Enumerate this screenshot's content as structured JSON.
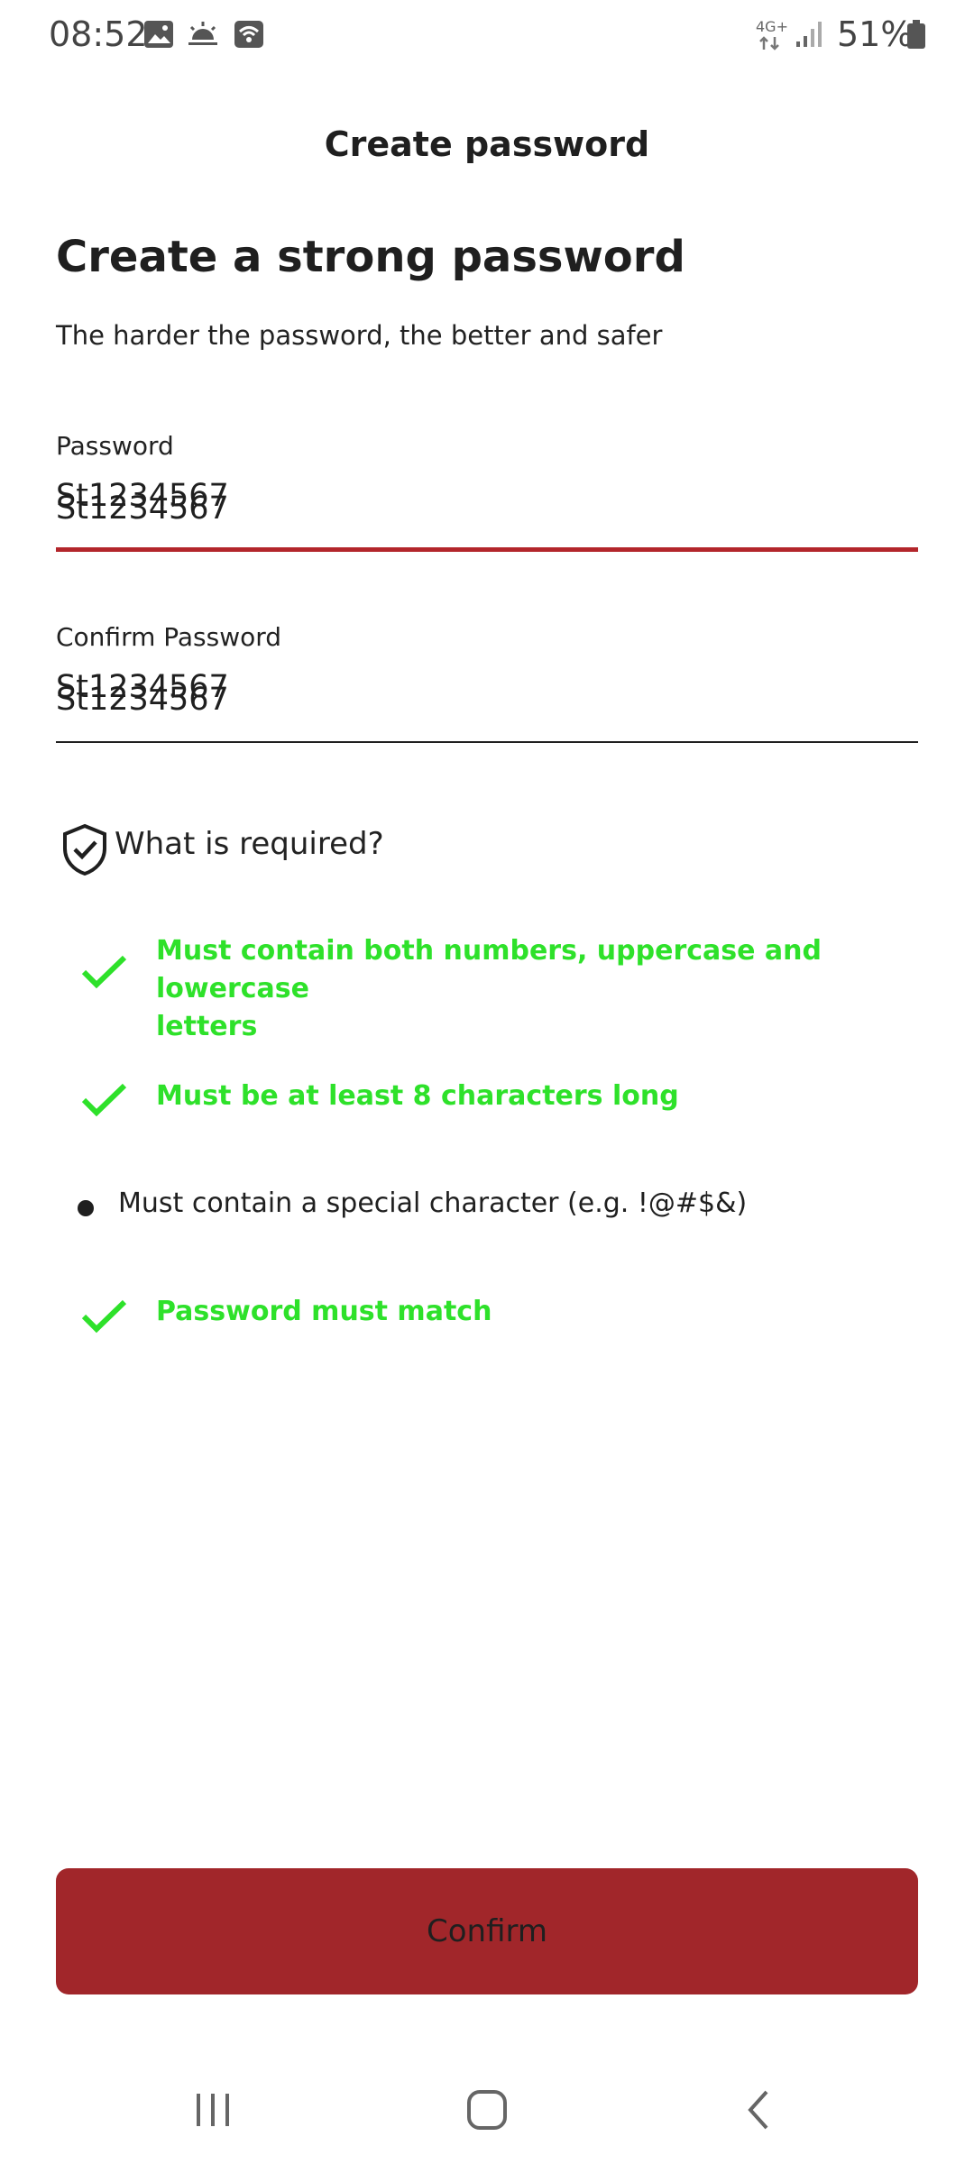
{
  "status_bar": {
    "time": "08:52",
    "network": "4G+",
    "battery_percent": "51%",
    "icons": [
      "image-icon",
      "weather-icon",
      "wifi-call-icon",
      "network-arrows-icon",
      "signal-icon",
      "battery-icon"
    ]
  },
  "header": {
    "title": "Create password"
  },
  "main": {
    "heading": "Create a strong password",
    "subtitle": "The harder the password, the better and safer",
    "password_field": {
      "label": "Password",
      "value": "St1234567",
      "underline_color": "#b3262b"
    },
    "confirm_field": {
      "label": "Confirm Password",
      "value": "St1234567",
      "underline_color": "#1f1f1f"
    },
    "requirements": {
      "title": "What is required?",
      "items": [
        {
          "text_line1": "Must contain both numbers, uppercase and lowercase",
          "text_line2": "letters",
          "met": true
        },
        {
          "text": "Must be at least 8 characters long",
          "met": true
        },
        {
          "text": "Must contain a special character (e.g. !@#$&)",
          "met": false
        },
        {
          "text": "Password must match",
          "met": true
        }
      ]
    }
  },
  "footer": {
    "confirm_label": "Confirm"
  },
  "colors": {
    "accent": "#a1262a",
    "success": "#2ee12a",
    "text": "#1f1f1f"
  },
  "navigation": {
    "items": [
      "recent-apps-icon",
      "home-icon",
      "back-icon"
    ]
  }
}
